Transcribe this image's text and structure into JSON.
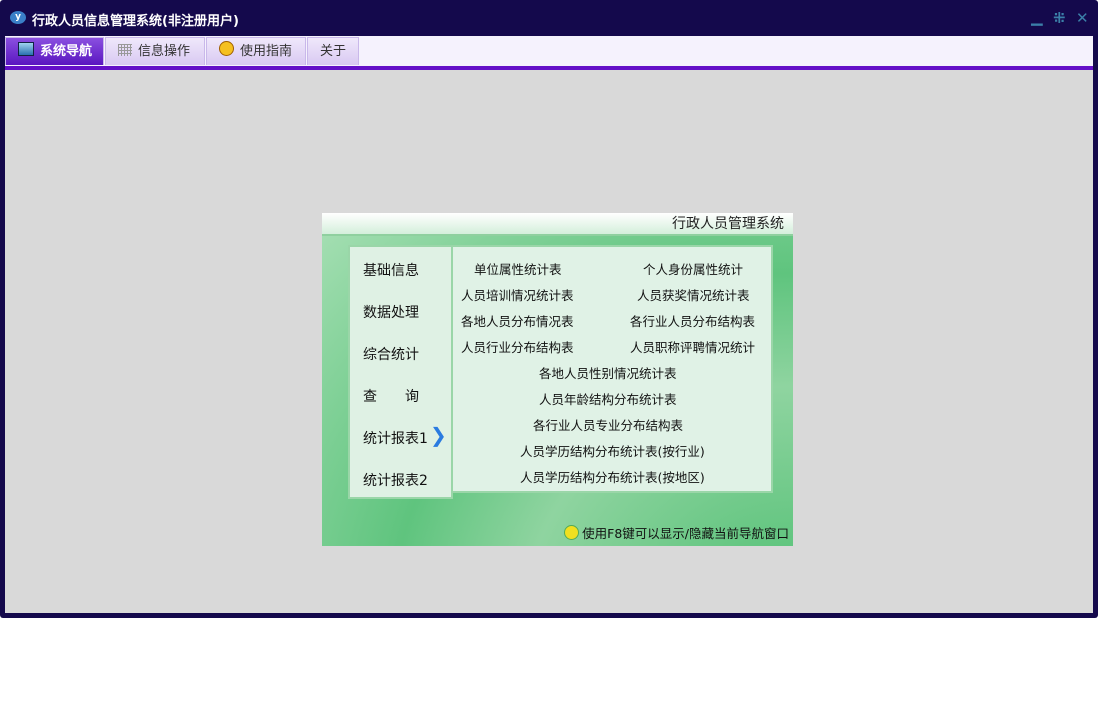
{
  "window": {
    "title": "行政人员信息管理系统(非注册用户)",
    "logo": "y"
  },
  "tabs": [
    {
      "label": "系统导航",
      "icon": "monitor-icon"
    },
    {
      "label": "信息操作",
      "icon": "grid-icon"
    },
    {
      "label": "使用指南",
      "icon": "help-icon"
    },
    {
      "label": "关于"
    }
  ],
  "panel": {
    "header": "行政人员管理系统",
    "menu": [
      "基础信息",
      "数据处理",
      "综合统计",
      "查　　询",
      "统计报表1",
      "统计报表2"
    ],
    "reports": [
      "单位属性统计表",
      "个人身份属性统计",
      "人员培训情况统计表",
      "人员获奖情况统计表",
      "各地人员分布情况表",
      "各行业人员分布结构表",
      "人员行业分布结构表",
      "人员职称评聘情况统计",
      "各地人员性别情况统计表",
      "人员年龄结构分布统计表",
      "各行业人员专业分布结构表",
      "人员学历结构分布统计表(按行业)",
      "人员学历结构分布统计表(按地区)"
    ],
    "tip": "使用F8键可以显示/隐藏当前导航窗口"
  },
  "colors": {
    "frame": "#14094c",
    "accent": "#6410c8"
  }
}
